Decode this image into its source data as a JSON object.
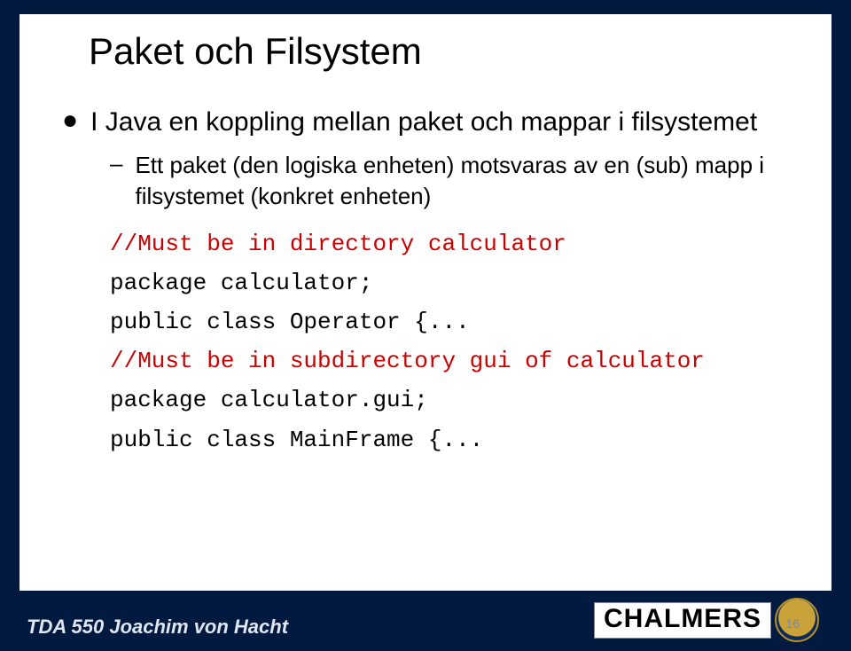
{
  "title": "Paket och Filsystem",
  "bullet1": "I Java en koppling mellan paket och mappar i filsystemet",
  "sub1a": "Ett paket (den logiska enheten) motsvaras av en (sub) mapp i filsystemet (konkret enheten)",
  "code": {
    "c1": "//Must be in directory calculator",
    "c2": "package calculator;",
    "c3": "public class Operator {...",
    "c4": "//Must be in subdirectory gui of calculator",
    "c5": "package calculator.gui;",
    "c6": "public class MainFrame {..."
  },
  "footer": "TDA 550 Joachim von Hacht",
  "brand": "CHALMERS",
  "pagenum": "16"
}
